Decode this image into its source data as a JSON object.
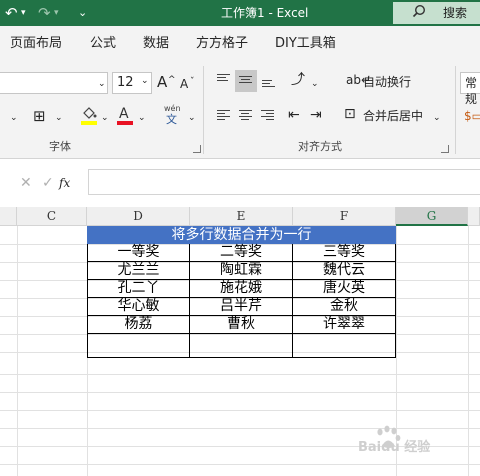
{
  "window": {
    "title": "工作簿1  -  Excel",
    "search_label": "搜索"
  },
  "tabs": [
    "页面布局",
    "公式",
    "数据",
    "方方格子",
    "DIY工具箱"
  ],
  "ribbon": {
    "font_size": "12",
    "grow_font": "A",
    "shrink_font": "A",
    "pinyin_top": "wén",
    "pinyin_bottom": "文",
    "wrap_text": "自动换行",
    "merge_center": "合并后居中",
    "number_format": "常规",
    "group_font": "字体",
    "group_align": "对齐方式"
  },
  "formula_bar": {
    "fx": "fx",
    "value": ""
  },
  "columns": [
    "C",
    "D",
    "E",
    "F",
    "G"
  ],
  "selected_column": "G",
  "sheet": {
    "title": "将多行数据合并为一行",
    "rows": [
      [
        "一等奖",
        "二等奖",
        "三等奖"
      ],
      [
        "尤兰兰",
        "陶虹霖",
        "魏代云"
      ],
      [
        "孔二丫",
        "施花娥",
        "唐火英"
      ],
      [
        "华心敏",
        "吕半芹",
        "金秋"
      ],
      [
        "杨荔",
        "曹秋",
        "许翠翠"
      ],
      [
        "",
        "",
        ""
      ]
    ]
  },
  "watermark": "Baidu 经验",
  "colors": {
    "excel_green": "#217346",
    "title_fill": "#4472c4"
  }
}
